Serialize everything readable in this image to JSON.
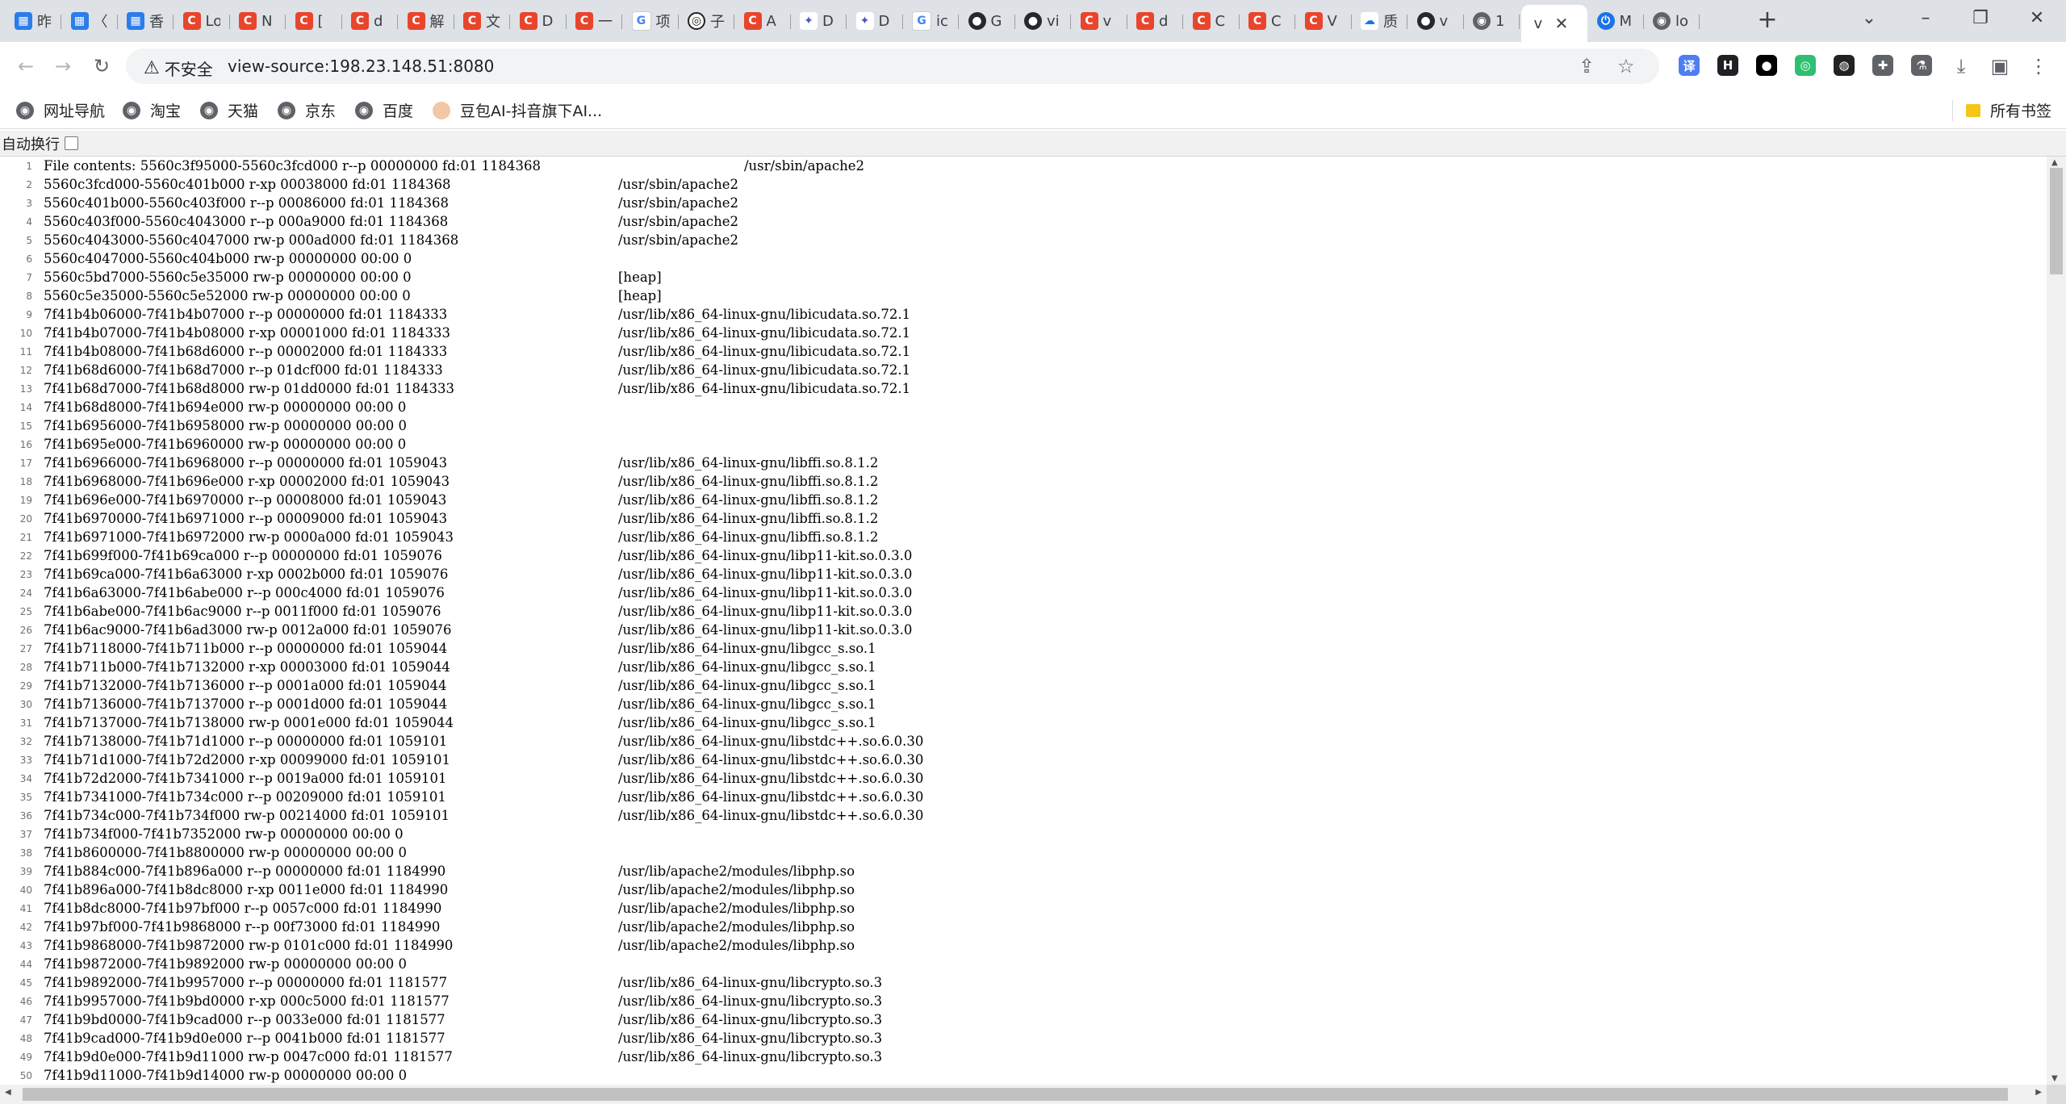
{
  "tabs": [
    {
      "icon": "calendar-icon",
      "cls": "calendar",
      "glyph": "▦",
      "label": "昨"
    },
    {
      "icon": "calendar-icon",
      "cls": "calendar",
      "glyph": "▦",
      "label": "〈"
    },
    {
      "icon": "calendar-icon",
      "cls": "calendar",
      "glyph": "▦",
      "label": "香"
    },
    {
      "icon": "csdn-icon",
      "cls": "csdn",
      "glyph": "C",
      "label": "Lo"
    },
    {
      "icon": "csdn-icon",
      "cls": "csdn",
      "glyph": "C",
      "label": "N"
    },
    {
      "icon": "csdn-icon",
      "cls": "csdn",
      "glyph": "C",
      "label": "["
    },
    {
      "icon": "csdn-icon",
      "cls": "csdn",
      "glyph": "C",
      "label": "d"
    },
    {
      "icon": "csdn-icon",
      "cls": "csdn",
      "glyph": "C",
      "label": "解"
    },
    {
      "icon": "csdn-icon",
      "cls": "csdn",
      "glyph": "C",
      "label": "文"
    },
    {
      "icon": "csdn-icon",
      "cls": "csdn",
      "glyph": "C",
      "label": "D"
    },
    {
      "icon": "csdn-icon",
      "cls": "csdn",
      "glyph": "C",
      "label": "一"
    },
    {
      "icon": "google-icon",
      "cls": "google",
      "glyph": "G",
      "label": "项"
    },
    {
      "icon": "swirl-icon",
      "cls": "swirl",
      "glyph": "◎",
      "label": "子"
    },
    {
      "icon": "csdn-icon",
      "cls": "csdn",
      "glyph": "C",
      "label": "A"
    },
    {
      "icon": "bird-icon",
      "cls": "bird",
      "glyph": "✦",
      "label": "D"
    },
    {
      "icon": "bird-icon",
      "cls": "bird",
      "glyph": "✦",
      "label": "D"
    },
    {
      "icon": "google-icon",
      "cls": "google",
      "glyph": "G",
      "label": "ic"
    },
    {
      "icon": "github-icon",
      "cls": "github",
      "glyph": "●",
      "label": "G"
    },
    {
      "icon": "github-icon",
      "cls": "github",
      "glyph": "●",
      "label": "vi"
    },
    {
      "icon": "csdn-icon",
      "cls": "csdn",
      "glyph": "C",
      "label": "v"
    },
    {
      "icon": "csdn-icon",
      "cls": "csdn",
      "glyph": "C",
      "label": "d"
    },
    {
      "icon": "csdn-icon",
      "cls": "csdn",
      "glyph": "C",
      "label": "C"
    },
    {
      "icon": "csdn-icon",
      "cls": "csdn",
      "glyph": "C",
      "label": "C"
    },
    {
      "icon": "csdn-icon",
      "cls": "csdn",
      "glyph": "C",
      "label": "V"
    },
    {
      "icon": "cloud-icon",
      "cls": "cloud",
      "glyph": "☁",
      "label": "质"
    },
    {
      "icon": "github-icon",
      "cls": "github",
      "glyph": "●",
      "label": "v"
    },
    {
      "icon": "globe-icon",
      "cls": "globe",
      "glyph": "◉",
      "label": "1"
    },
    {
      "icon": "tab-blank-icon",
      "cls": "",
      "glyph": "",
      "label": "v",
      "active": true
    },
    {
      "icon": "power-icon",
      "cls": "power",
      "glyph": "⏻",
      "label": "M"
    },
    {
      "icon": "globe-icon",
      "cls": "globe",
      "glyph": "◉",
      "label": "lo"
    }
  ],
  "toolbar": {
    "security_label": "不安全",
    "url": "view-source:198.23.148.51:8080"
  },
  "extensions": [
    {
      "name": "translate-extension-icon",
      "glyph": "译",
      "color": "#4f7ef2"
    },
    {
      "name": "h-extension-icon",
      "glyph": "H",
      "color": "#202124"
    },
    {
      "name": "circle-extension-icon",
      "glyph": "●",
      "color": "#000000"
    },
    {
      "name": "green-extension-icon",
      "glyph": "◎",
      "color": "#2fbf71"
    },
    {
      "name": "tampermonkey-extension-icon",
      "glyph": "◍",
      "color": "#222222"
    },
    {
      "name": "puzzle-extension-icon",
      "glyph": "✚",
      "color": "#5f6368"
    },
    {
      "name": "flask-extension-icon",
      "glyph": "⚗",
      "color": "#5f6368"
    }
  ],
  "bookmarks": [
    {
      "label": "网址导航",
      "icon": "globe-icon"
    },
    {
      "label": "淘宝",
      "icon": "globe-icon"
    },
    {
      "label": "天猫",
      "icon": "globe-icon"
    },
    {
      "label": "京东",
      "icon": "globe-icon"
    },
    {
      "label": "百度",
      "icon": "globe-icon"
    },
    {
      "label": "豆包AI-抖音旗下AI...",
      "icon": "doubao-icon"
    }
  ],
  "all_bookmarks_label": "所有书签",
  "source_view": {
    "wrap_label": "自动换行",
    "lines": [
      {
        "n": "1",
        "addr": "File contents: 5560c3f95000-5560c3fcd000 r--p 00000000 fd:01 1184368",
        "path": "/usr/sbin/apache2",
        "first": true
      },
      {
        "n": "2",
        "addr": "5560c3fcd000-5560c401b000 r-xp 00038000 fd:01 1184368",
        "path": "/usr/sbin/apache2"
      },
      {
        "n": "3",
        "addr": "5560c401b000-5560c403f000 r--p 00086000 fd:01 1184368",
        "path": "/usr/sbin/apache2"
      },
      {
        "n": "4",
        "addr": "5560c403f000-5560c4043000 r--p 000a9000 fd:01 1184368",
        "path": "/usr/sbin/apache2"
      },
      {
        "n": "5",
        "addr": "5560c4043000-5560c4047000 rw-p 000ad000 fd:01 1184368",
        "path": "/usr/sbin/apache2"
      },
      {
        "n": "6",
        "addr": "5560c4047000-5560c404b000 rw-p 00000000 00:00 0",
        "path": ""
      },
      {
        "n": "7",
        "addr": "5560c5bd7000-5560c5e35000 rw-p 00000000 00:00 0",
        "path": "[heap]"
      },
      {
        "n": "8",
        "addr": "5560c5e35000-5560c5e52000 rw-p 00000000 00:00 0",
        "path": "[heap]"
      },
      {
        "n": "9",
        "addr": "7f41b4b06000-7f41b4b07000 r--p 00000000 fd:01 1184333",
        "path": "/usr/lib/x86_64-linux-gnu/libicudata.so.72.1"
      },
      {
        "n": "10",
        "addr": "7f41b4b07000-7f41b4b08000 r-xp 00001000 fd:01 1184333",
        "path": "/usr/lib/x86_64-linux-gnu/libicudata.so.72.1"
      },
      {
        "n": "11",
        "addr": "7f41b4b08000-7f41b68d6000 r--p 00002000 fd:01 1184333",
        "path": "/usr/lib/x86_64-linux-gnu/libicudata.so.72.1"
      },
      {
        "n": "12",
        "addr": "7f41b68d6000-7f41b68d7000 r--p 01dcf000 fd:01 1184333",
        "path": "/usr/lib/x86_64-linux-gnu/libicudata.so.72.1"
      },
      {
        "n": "13",
        "addr": "7f41b68d7000-7f41b68d8000 rw-p 01dd0000 fd:01 1184333",
        "path": "/usr/lib/x86_64-linux-gnu/libicudata.so.72.1"
      },
      {
        "n": "14",
        "addr": "7f41b68d8000-7f41b694e000 rw-p 00000000 00:00 0",
        "path": ""
      },
      {
        "n": "15",
        "addr": "7f41b6956000-7f41b6958000 rw-p 00000000 00:00 0",
        "path": ""
      },
      {
        "n": "16",
        "addr": "7f41b695e000-7f41b6960000 rw-p 00000000 00:00 0",
        "path": ""
      },
      {
        "n": "17",
        "addr": "7f41b6966000-7f41b6968000 r--p 00000000 fd:01 1059043",
        "path": "/usr/lib/x86_64-linux-gnu/libffi.so.8.1.2"
      },
      {
        "n": "18",
        "addr": "7f41b6968000-7f41b696e000 r-xp 00002000 fd:01 1059043",
        "path": "/usr/lib/x86_64-linux-gnu/libffi.so.8.1.2"
      },
      {
        "n": "19",
        "addr": "7f41b696e000-7f41b6970000 r--p 00008000 fd:01 1059043",
        "path": "/usr/lib/x86_64-linux-gnu/libffi.so.8.1.2"
      },
      {
        "n": "20",
        "addr": "7f41b6970000-7f41b6971000 r--p 00009000 fd:01 1059043",
        "path": "/usr/lib/x86_64-linux-gnu/libffi.so.8.1.2"
      },
      {
        "n": "21",
        "addr": "7f41b6971000-7f41b6972000 rw-p 0000a000 fd:01 1059043",
        "path": "/usr/lib/x86_64-linux-gnu/libffi.so.8.1.2"
      },
      {
        "n": "22",
        "addr": "7f41b699f000-7f41b69ca000 r--p 00000000 fd:01 1059076",
        "path": "/usr/lib/x86_64-linux-gnu/libp11-kit.so.0.3.0"
      },
      {
        "n": "23",
        "addr": "7f41b69ca000-7f41b6a63000 r-xp 0002b000 fd:01 1059076",
        "path": "/usr/lib/x86_64-linux-gnu/libp11-kit.so.0.3.0"
      },
      {
        "n": "24",
        "addr": "7f41b6a63000-7f41b6abe000 r--p 000c4000 fd:01 1059076",
        "path": "/usr/lib/x86_64-linux-gnu/libp11-kit.so.0.3.0"
      },
      {
        "n": "25",
        "addr": "7f41b6abe000-7f41b6ac9000 r--p 0011f000 fd:01 1059076",
        "path": "/usr/lib/x86_64-linux-gnu/libp11-kit.so.0.3.0"
      },
      {
        "n": "26",
        "addr": "7f41b6ac9000-7f41b6ad3000 rw-p 0012a000 fd:01 1059076",
        "path": "/usr/lib/x86_64-linux-gnu/libp11-kit.so.0.3.0"
      },
      {
        "n": "27",
        "addr": "7f41b7118000-7f41b711b000 r--p 00000000 fd:01 1059044",
        "path": "/usr/lib/x86_64-linux-gnu/libgcc_s.so.1"
      },
      {
        "n": "28",
        "addr": "7f41b711b000-7f41b7132000 r-xp 00003000 fd:01 1059044",
        "path": "/usr/lib/x86_64-linux-gnu/libgcc_s.so.1"
      },
      {
        "n": "29",
        "addr": "7f41b7132000-7f41b7136000 r--p 0001a000 fd:01 1059044",
        "path": "/usr/lib/x86_64-linux-gnu/libgcc_s.so.1"
      },
      {
        "n": "30",
        "addr": "7f41b7136000-7f41b7137000 r--p 0001d000 fd:01 1059044",
        "path": "/usr/lib/x86_64-linux-gnu/libgcc_s.so.1"
      },
      {
        "n": "31",
        "addr": "7f41b7137000-7f41b7138000 rw-p 0001e000 fd:01 1059044",
        "path": "/usr/lib/x86_64-linux-gnu/libgcc_s.so.1"
      },
      {
        "n": "32",
        "addr": "7f41b7138000-7f41b71d1000 r--p 00000000 fd:01 1059101",
        "path": "/usr/lib/x86_64-linux-gnu/libstdc++.so.6.0.30"
      },
      {
        "n": "33",
        "addr": "7f41b71d1000-7f41b72d2000 r-xp 00099000 fd:01 1059101",
        "path": "/usr/lib/x86_64-linux-gnu/libstdc++.so.6.0.30"
      },
      {
        "n": "34",
        "addr": "7f41b72d2000-7f41b7341000 r--p 0019a000 fd:01 1059101",
        "path": "/usr/lib/x86_64-linux-gnu/libstdc++.so.6.0.30"
      },
      {
        "n": "35",
        "addr": "7f41b7341000-7f41b734c000 r--p 00209000 fd:01 1059101",
        "path": "/usr/lib/x86_64-linux-gnu/libstdc++.so.6.0.30"
      },
      {
        "n": "36",
        "addr": "7f41b734c000-7f41b734f000 rw-p 00214000 fd:01 1059101",
        "path": "/usr/lib/x86_64-linux-gnu/libstdc++.so.6.0.30"
      },
      {
        "n": "37",
        "addr": "7f41b734f000-7f41b7352000 rw-p 00000000 00:00 0",
        "path": ""
      },
      {
        "n": "38",
        "addr": "7f41b8600000-7f41b8800000 rw-p 00000000 00:00 0",
        "path": ""
      },
      {
        "n": "39",
        "addr": "7f41b884c000-7f41b896a000 r--p 00000000 fd:01 1184990",
        "path": "/usr/lib/apache2/modules/libphp.so"
      },
      {
        "n": "40",
        "addr": "7f41b896a000-7f41b8dc8000 r-xp 0011e000 fd:01 1184990",
        "path": "/usr/lib/apache2/modules/libphp.so"
      },
      {
        "n": "41",
        "addr": "7f41b8dc8000-7f41b97bf000 r--p 0057c000 fd:01 1184990",
        "path": "/usr/lib/apache2/modules/libphp.so"
      },
      {
        "n": "42",
        "addr": "7f41b97bf000-7f41b9868000 r--p 00f73000 fd:01 1184990",
        "path": "/usr/lib/apache2/modules/libphp.so"
      },
      {
        "n": "43",
        "addr": "7f41b9868000-7f41b9872000 rw-p 0101c000 fd:01 1184990",
        "path": "/usr/lib/apache2/modules/libphp.so"
      },
      {
        "n": "44",
        "addr": "7f41b9872000-7f41b9892000 rw-p 00000000 00:00 0",
        "path": ""
      },
      {
        "n": "45",
        "addr": "7f41b9892000-7f41b9957000 r--p 00000000 fd:01 1181577",
        "path": "/usr/lib/x86_64-linux-gnu/libcrypto.so.3"
      },
      {
        "n": "46",
        "addr": "7f41b9957000-7f41b9bd0000 r-xp 000c5000 fd:01 1181577",
        "path": "/usr/lib/x86_64-linux-gnu/libcrypto.so.3"
      },
      {
        "n": "47",
        "addr": "7f41b9bd0000-7f41b9cad000 r--p 0033e000 fd:01 1181577",
        "path": "/usr/lib/x86_64-linux-gnu/libcrypto.so.3"
      },
      {
        "n": "48",
        "addr": "7f41b9cad000-7f41b9d0e000 r--p 0041b000 fd:01 1181577",
        "path": "/usr/lib/x86_64-linux-gnu/libcrypto.so.3"
      },
      {
        "n": "49",
        "addr": "7f41b9d0e000-7f41b9d11000 rw-p 0047c000 fd:01 1181577",
        "path": "/usr/lib/x86_64-linux-gnu/libcrypto.so.3"
      },
      {
        "n": "50",
        "addr": "7f41b9d11000-7f41b9d14000 rw-p 00000000 00:00 0",
        "path": ""
      }
    ]
  }
}
